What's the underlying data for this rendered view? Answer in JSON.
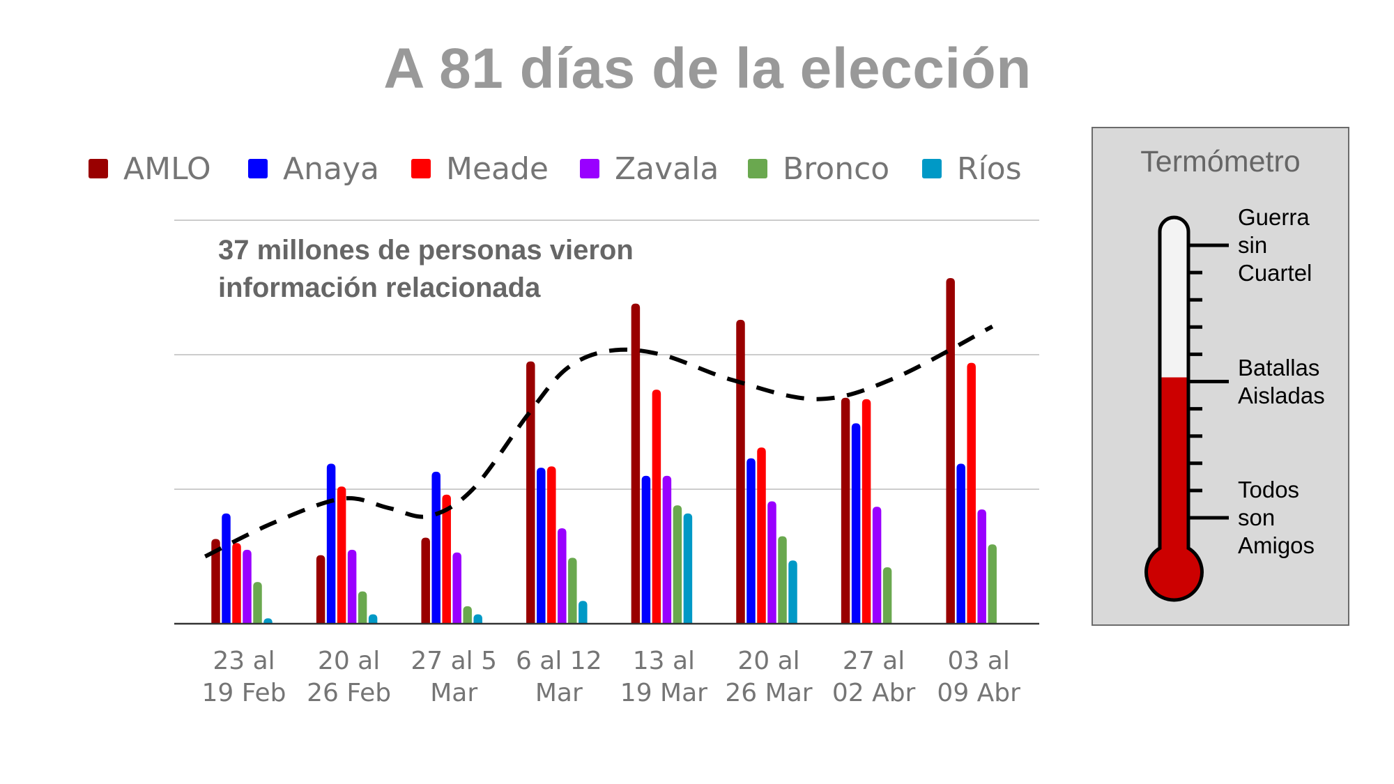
{
  "title": "A 81 días de la elección",
  "annotation": {
    "line1": "37 millones de personas vieron",
    "line2": "información relacionada"
  },
  "legend": [
    {
      "name": "AMLO",
      "color": "#990000"
    },
    {
      "name": "Anaya",
      "color": "#0000ff"
    },
    {
      "name": "Meade",
      "color": "#ff0000"
    },
    {
      "name": "Zavala",
      "color": "#9900ff"
    },
    {
      "name": "Bronco",
      "color": "#6aa84f"
    },
    {
      "name": "Ríos",
      "color": "#0099c6"
    }
  ],
  "chart_data": {
    "type": "bar",
    "title": "A 81 días de la elección",
    "xlabel": "",
    "ylabel": "",
    "ylim": [
      0,
      3
    ],
    "grid": true,
    "legend_position": "top",
    "y_tick_labels_shown": false,
    "categories": [
      [
        "23 al",
        "19 Feb"
      ],
      [
        "20 al",
        "26 Feb"
      ],
      [
        "27 al 5",
        "Mar"
      ],
      [
        "6 al 12",
        "Mar"
      ],
      [
        "13 al",
        "19 Mar"
      ],
      [
        "20 al",
        "26 Mar"
      ],
      [
        "27 al",
        "02 Abr"
      ],
      [
        "03 al",
        "09 Abr"
      ]
    ],
    "gridlines": [
      1,
      2,
      3
    ],
    "series": [
      {
        "name": "AMLO",
        "color": "#990000",
        "values": [
          0.63,
          0.51,
          0.64,
          1.95,
          2.38,
          2.26,
          1.68,
          2.57
        ]
      },
      {
        "name": "Anaya",
        "color": "#0000ff",
        "values": [
          0.82,
          1.19,
          1.13,
          1.16,
          1.1,
          1.23,
          1.49,
          1.19
        ]
      },
      {
        "name": "Meade",
        "color": "#ff0000",
        "values": [
          0.6,
          1.02,
          0.96,
          1.17,
          1.74,
          1.31,
          1.67,
          1.94
        ]
      },
      {
        "name": "Zavala",
        "color": "#9900ff",
        "values": [
          0.55,
          0.55,
          0.53,
          0.71,
          1.1,
          0.91,
          0.87,
          0.85
        ]
      },
      {
        "name": "Bronco",
        "color": "#6aa84f",
        "values": [
          0.31,
          0.24,
          0.13,
          0.49,
          0.88,
          0.65,
          0.42,
          0.59
        ]
      },
      {
        "name": "Ríos",
        "color": "#0099c6",
        "values": [
          0.04,
          0.07,
          0.07,
          0.17,
          0.82,
          0.47,
          0,
          0
        ]
      }
    ],
    "trendline": {
      "style": "dashed",
      "color": "#000000",
      "points": [
        [
          -0.35,
          0.5
        ],
        [
          0.3,
          0.75
        ],
        [
          0.96,
          0.93
        ],
        [
          1.4,
          0.86
        ],
        [
          1.78,
          0.8
        ],
        [
          2.2,
          1.0
        ],
        [
          2.73,
          1.56
        ],
        [
          3.1,
          1.9
        ],
        [
          3.51,
          2.03
        ],
        [
          4.0,
          2.0
        ],
        [
          4.68,
          1.81
        ],
        [
          5.48,
          1.67
        ],
        [
          6.2,
          1.82
        ],
        [
          7.15,
          2.21
        ]
      ]
    },
    "annotation": "37 millones de personas vieron información relacionada"
  },
  "thermometer": {
    "title": "Termómetro",
    "levels": [
      {
        "label_lines": [
          "Guerra",
          "sin",
          "Cuartel"
        ],
        "position": 1.0
      },
      {
        "label_lines": [
          "Batallas",
          "Aisladas"
        ],
        "position": 0.5
      },
      {
        "label_lines": [
          "Todos",
          "son",
          "Amigos"
        ],
        "position": 0.0
      }
    ],
    "fill_level": 0.5,
    "fill_color": "#cc0000",
    "empty_color": "#f3f3f3"
  }
}
